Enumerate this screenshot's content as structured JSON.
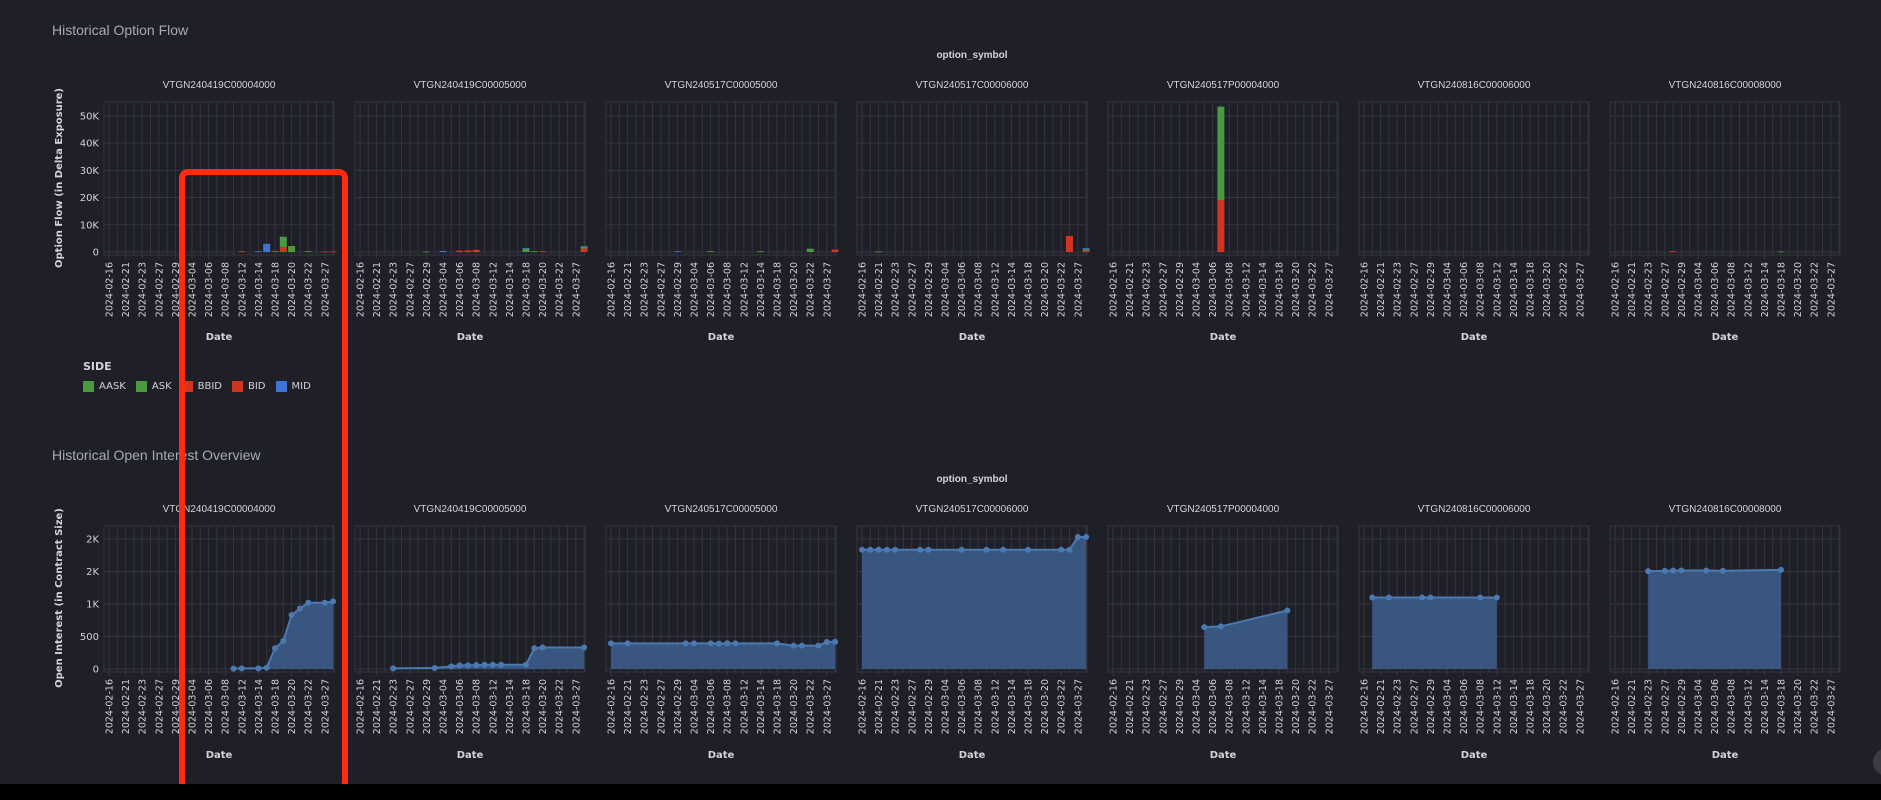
{
  "sections": {
    "flow_title": "Historical Option Flow",
    "oi_title": "Historical Open Interest Overview"
  },
  "legend": {
    "title": "SIDE",
    "items": [
      {
        "label": "AASK",
        "color": "#4c9a3f"
      },
      {
        "label": "ASK",
        "color": "#4c9a3f"
      },
      {
        "label": "BBID",
        "color": "#d0361f"
      },
      {
        "label": "BID",
        "color": "#d0361f"
      },
      {
        "label": "MID",
        "color": "#3f73d6"
      }
    ]
  },
  "colors": {
    "background": "#1e1f27",
    "grid": "#34353f",
    "text": "#d4d4d8",
    "ASK": "#4c9a3f",
    "BID": "#d0361f",
    "MID": "#3f73d6",
    "area_fill": "#3a5a84",
    "area_line": "#4b79b2"
  },
  "chart_data": [
    {
      "type": "bar",
      "stacked": true,
      "facet_label": "option_symbol",
      "xlabel": "Date",
      "ylabel": "Option Flow (in Delta Exposure)",
      "ylim": [
        0,
        55100
      ],
      "yticks": [
        0,
        10000,
        20000,
        30000,
        40000,
        50000
      ],
      "ytick_labels": [
        "0",
        "10K",
        "20K",
        "30K",
        "40K",
        "50K"
      ],
      "categories": [
        "2024-02-16",
        "2024-02-20",
        "2024-02-21",
        "2024-02-22",
        "2024-02-23",
        "2024-02-26",
        "2024-02-27",
        "2024-02-28",
        "2024-02-29",
        "2024-03-01",
        "2024-03-04",
        "2024-03-05",
        "2024-03-06",
        "2024-03-07",
        "2024-03-08",
        "2024-03-11",
        "2024-03-12",
        "2024-03-13",
        "2024-03-14",
        "2024-03-15",
        "2024-03-18",
        "2024-03-19",
        "2024-03-20",
        "2024-03-21",
        "2024-03-22",
        "2024-03-26",
        "2024-03-27",
        "2024-03-28"
      ],
      "tick_labels": [
        "2024-02-16",
        "2024-02-21",
        "2024-02-23",
        "2024-02-27",
        "2024-02-29",
        "2024-03-04",
        "2024-03-06",
        "2024-03-08",
        "2024-03-12",
        "2024-03-14",
        "2024-03-18",
        "2024-03-20",
        "2024-03-22",
        "2024-03-27"
      ],
      "panels": [
        {
          "symbol": "VTGN240419C00004000",
          "series": {
            "BID": {
              "2024-03-12": 300,
              "2024-03-18": 400,
              "2024-03-19": 1800,
              "2024-03-27": 200,
              "2024-03-28": 200
            },
            "ASK": {
              "2024-03-19": 3800,
              "2024-03-20": 2200,
              "2024-03-22": 300
            },
            "MID": {
              "2024-03-14": 300,
              "2024-03-15": 3000
            }
          }
        },
        {
          "symbol": "VTGN240419C00005000",
          "series": {
            "BID": {
              "2024-03-06": 500,
              "2024-03-07": 600,
              "2024-03-08": 800,
              "2024-03-20": 300,
              "2024-03-28": 1300
            },
            "ASK": {
              "2024-02-29": 200,
              "2024-03-18": 1200,
              "2024-03-19": 300,
              "2024-03-28": 600
            },
            "MID": {
              "2024-03-04": 400,
              "2024-03-18": 300,
              "2024-03-28": 300
            }
          }
        },
        {
          "symbol": "VTGN240517C00005000",
          "series": {
            "BID": {
              "2024-03-28": 900
            },
            "ASK": {
              "2024-03-06": 300,
              "2024-03-14": 300,
              "2024-03-22": 1200
            },
            "MID": {
              "2024-02-29": 300
            }
          }
        },
        {
          "symbol": "VTGN240517C00006000",
          "series": {
            "BID": {
              "2024-03-26": 5900,
              "2024-03-28": 500
            },
            "ASK": {
              "2024-02-21": 200,
              "2024-03-28": 500
            },
            "MID": {
              "2024-03-28": 400
            }
          }
        },
        {
          "symbol": "VTGN240517P00004000",
          "series": {
            "BID": {
              "2024-03-07": 19100
            },
            "ASK": {
              "2024-03-07": 34300
            },
            "MID": {}
          }
        },
        {
          "symbol": "VTGN240816C00006000",
          "series": {
            "BID": {},
            "ASK": {},
            "MID": {}
          }
        },
        {
          "symbol": "VTGN240816C00008000",
          "series": {
            "BID": {
              "2024-02-28": 300
            },
            "ASK": {
              "2024-03-18": 200
            },
            "MID": {}
          }
        }
      ]
    },
    {
      "type": "area",
      "facet_label": "option_symbol",
      "xlabel": "Date",
      "ylabel": "Open Interest (in Contract Size)",
      "ylim": [
        0,
        2200
      ],
      "yticks": [
        0,
        500,
        1000,
        1500,
        2000
      ],
      "ytick_labels": [
        "0",
        "500",
        "1K",
        "2K",
        "2K"
      ],
      "categories": [
        "2024-02-16",
        "2024-02-20",
        "2024-02-21",
        "2024-02-22",
        "2024-02-23",
        "2024-02-26",
        "2024-02-27",
        "2024-02-28",
        "2024-02-29",
        "2024-03-01",
        "2024-03-04",
        "2024-03-05",
        "2024-03-06",
        "2024-03-07",
        "2024-03-08",
        "2024-03-11",
        "2024-03-12",
        "2024-03-13",
        "2024-03-14",
        "2024-03-15",
        "2024-03-18",
        "2024-03-19",
        "2024-03-20",
        "2024-03-21",
        "2024-03-22",
        "2024-03-26",
        "2024-03-27",
        "2024-03-28"
      ],
      "tick_labels": [
        "2024-02-16",
        "2024-02-21",
        "2024-02-23",
        "2024-02-27",
        "2024-02-29",
        "2024-03-04",
        "2024-03-06",
        "2024-03-08",
        "2024-03-12",
        "2024-03-14",
        "2024-03-18",
        "2024-03-20",
        "2024-03-22",
        "2024-03-27"
      ],
      "panels": [
        {
          "symbol": "VTGN240419C00004000",
          "points": {
            "2024-03-11": 5,
            "2024-03-12": 10,
            "2024-03-14": 10,
            "2024-03-15": 20,
            "2024-03-18": 320,
            "2024-03-19": 430,
            "2024-03-20": 830,
            "2024-03-21": 930,
            "2024-03-22": 1020,
            "2024-03-27": 1020,
            "2024-03-28": 1040
          }
        },
        {
          "symbol": "VTGN240419C00005000",
          "points": {
            "2024-02-23": 10,
            "2024-03-01": 15,
            "2024-03-05": 40,
            "2024-03-06": 55,
            "2024-03-07": 55,
            "2024-03-08": 60,
            "2024-03-11": 65,
            "2024-03-12": 65,
            "2024-03-13": 65,
            "2024-03-18": 65,
            "2024-03-19": 320,
            "2024-03-20": 330,
            "2024-03-28": 330
          }
        },
        {
          "symbol": "VTGN240517C00005000",
          "points": {
            "2024-02-16": 395,
            "2024-02-21": 395,
            "2024-03-01": 395,
            "2024-03-04": 395,
            "2024-03-06": 395,
            "2024-03-07": 390,
            "2024-03-08": 395,
            "2024-03-11": 395,
            "2024-03-18": 395,
            "2024-03-20": 360,
            "2024-03-21": 360,
            "2024-03-26": 360,
            "2024-03-27": 415,
            "2024-03-28": 420
          }
        },
        {
          "symbol": "VTGN240517C00006000",
          "points": {
            "2024-02-16": 1835,
            "2024-02-20": 1835,
            "2024-02-21": 1835,
            "2024-02-22": 1835,
            "2024-02-23": 1835,
            "2024-02-28": 1835,
            "2024-02-29": 1835,
            "2024-03-06": 1835,
            "2024-03-11": 1835,
            "2024-03-13": 1835,
            "2024-03-18": 1835,
            "2024-03-22": 1835,
            "2024-03-26": 1835,
            "2024-03-27": 2030,
            "2024-03-28": 2030
          }
        },
        {
          "symbol": "VTGN240517P00004000",
          "points": {
            "2024-03-05": 645,
            "2024-03-07": 655,
            "2024-03-19": 900
          }
        },
        {
          "symbol": "VTGN240816C00006000",
          "points": {
            "2024-02-20": 1100,
            "2024-02-22": 1100,
            "2024-02-28": 1100,
            "2024-02-29": 1100,
            "2024-03-08": 1100,
            "2024-03-12": 1100
          }
        },
        {
          "symbol": "VTGN240816C00008000",
          "points": {
            "2024-02-23": 1505,
            "2024-02-27": 1510,
            "2024-02-28": 1515,
            "2024-02-29": 1515,
            "2024-03-05": 1515,
            "2024-03-07": 1510,
            "2024-03-18": 1525
          }
        }
      ]
    }
  ]
}
